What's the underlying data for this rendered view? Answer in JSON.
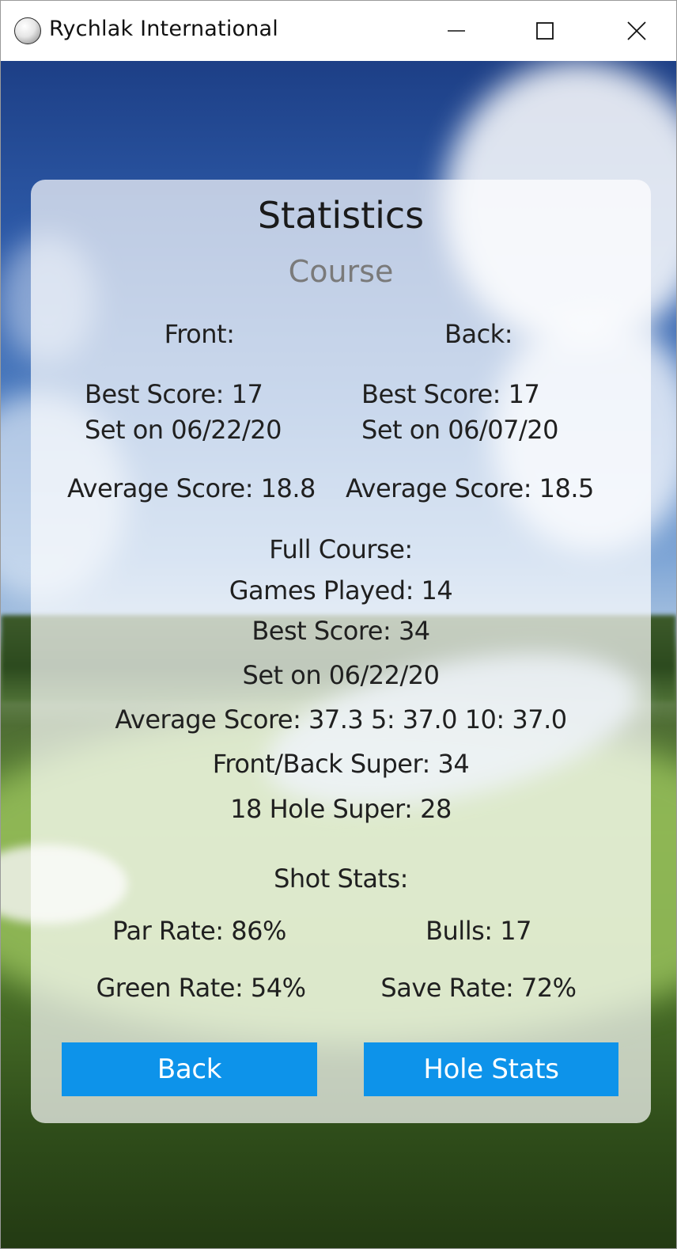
{
  "window": {
    "title": "Rychlak International",
    "app_icon": "golf-ball-icon",
    "controls": [
      "minimize-icon",
      "maximize-icon",
      "close-icon"
    ]
  },
  "stats": {
    "title": "Statistics",
    "subtitle": "Course",
    "front": {
      "label": "Front:",
      "best_score": "Best Score: 17",
      "set_on": "Set on 06/22/20",
      "average": "Average Score: 18.8"
    },
    "back": {
      "label": "Back:",
      "best_score": "Best Score: 17",
      "set_on": "Set on 06/07/20",
      "average": "Average Score: 18.5"
    },
    "full_course": {
      "label": "Full Course:",
      "games_played": "Games Played: 14",
      "best_score": "Best Score: 34",
      "set_on": "Set on 06/22/20",
      "average": "Average Score: 37.3  5: 37.0  10: 37.0",
      "front_back_super": "Front/Back Super: 34",
      "hole18_super": "18 Hole Super: 28"
    },
    "shot_stats": {
      "label": "Shot Stats:",
      "par_rate": "Par Rate: 86%",
      "bulls": "Bulls: 17",
      "green_rate": "Green Rate: 54%",
      "save_rate": "Save Rate: 72%"
    }
  },
  "buttons": {
    "back": "Back",
    "hole_stats": "Hole Stats"
  },
  "colors": {
    "button_bg": "#0d93ea",
    "button_text": "#ffffff",
    "subtitle": "#7a7a7a"
  }
}
